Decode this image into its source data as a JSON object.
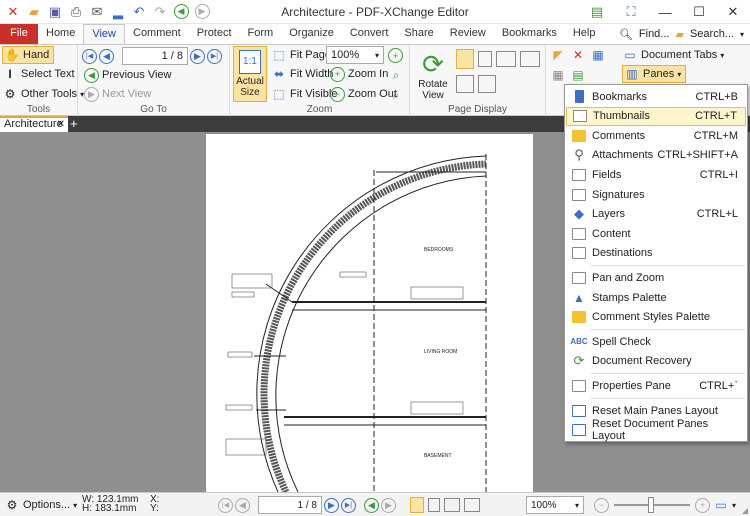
{
  "window": {
    "title": "Architecture - PDF-XChange Editor"
  },
  "quick_access": [
    "app-icon",
    "open-icon",
    "save-icon",
    "print-icon",
    "email-icon",
    "scan-icon",
    "undo-icon",
    "redo-icon",
    "back-icon",
    "forward-icon"
  ],
  "tabs": [
    {
      "label": "File",
      "name": "tab-file"
    },
    {
      "label": "Home",
      "name": "tab-home"
    },
    {
      "label": "View",
      "name": "tab-view",
      "active": true
    },
    {
      "label": "Comment",
      "name": "tab-comment"
    },
    {
      "label": "Protect",
      "name": "tab-protect"
    },
    {
      "label": "Form",
      "name": "tab-form"
    },
    {
      "label": "Organize",
      "name": "tab-organize"
    },
    {
      "label": "Convert",
      "name": "tab-convert"
    },
    {
      "label": "Share",
      "name": "tab-share"
    },
    {
      "label": "Review",
      "name": "tab-review"
    },
    {
      "label": "Bookmarks",
      "name": "tab-bookmarks"
    },
    {
      "label": "Help",
      "name": "tab-help"
    }
  ],
  "tabs_right": {
    "find": "Find...",
    "search": "Search..."
  },
  "ribbon": {
    "tools": {
      "hand": "Hand",
      "select_text": "Select Text",
      "other_tools": "Other Tools",
      "label": "Tools"
    },
    "goto": {
      "page_value": "1",
      "page_total": "/ 8",
      "previous_view": "Previous View",
      "next_view": "Next View",
      "label": "Go To"
    },
    "zoom": {
      "actual_size": "Actual Size",
      "fit_page": "Fit Page",
      "fit_width": "Fit Width",
      "fit_visible": "Fit Visible",
      "zoom_value": "100%",
      "zoom_in": "Zoom In",
      "zoom_out": "Zoom Out",
      "label": "Zoom"
    },
    "page_display": {
      "rotate_view": "Rotate View",
      "label": "Page Display"
    },
    "window": {
      "document_tabs": "Document Tabs",
      "panes": "Panes"
    }
  },
  "document_tab": {
    "label": "Architecture"
  },
  "drawing": {
    "bedrooms": "BEDROOMS",
    "living_room": "LIVING ROOM",
    "basement": "BASEMENT"
  },
  "status": {
    "options": "Options...",
    "width": "W: 123.1mm",
    "height": "H: 183.1mm",
    "x": "X:",
    "y": "Y:",
    "page_value": "1",
    "page_total": "/ 8",
    "zoom": "100%"
  },
  "panes_menu": {
    "items": [
      {
        "label": "Bookmarks",
        "shortcut": "CTRL+B",
        "icon": "bookmark-icon"
      },
      {
        "label": "Thumbnails",
        "shortcut": "CTRL+T",
        "icon": "thumbnails-icon",
        "highlighted": true
      },
      {
        "label": "Comments",
        "shortcut": "CTRL+M",
        "icon": "comments-icon"
      },
      {
        "label": "Attachments",
        "shortcut": "CTRL+SHIFT+A",
        "icon": "paperclip-icon"
      },
      {
        "label": "Fields",
        "shortcut": "CTRL+I",
        "icon": "fields-icon"
      },
      {
        "label": "Signatures",
        "shortcut": "",
        "icon": "signature-icon"
      },
      {
        "label": "Layers",
        "shortcut": "CTRL+L",
        "icon": "layers-icon"
      },
      {
        "label": "Content",
        "shortcut": "",
        "icon": "content-icon"
      },
      {
        "label": "Destinations",
        "shortcut": "",
        "icon": "destinations-icon"
      },
      {
        "label": "Pan and Zoom",
        "shortcut": "",
        "icon": "pan-zoom-icon"
      },
      {
        "label": "Stamps Palette",
        "shortcut": "",
        "icon": "stamp-icon"
      },
      {
        "label": "Comment Styles Palette",
        "shortcut": "",
        "icon": "comment-styles-icon"
      },
      {
        "label": "Spell Check",
        "shortcut": "",
        "icon": "spell-check-icon"
      },
      {
        "label": "Document Recovery",
        "shortcut": "",
        "icon": "recovery-icon"
      },
      {
        "label": "Properties Pane",
        "shortcut": "CTRL+`",
        "icon": "properties-icon"
      },
      {
        "label": "Reset Main Panes Layout",
        "shortcut": "",
        "icon": "reset-layout-icon"
      },
      {
        "label": "Reset Document Panes Layout",
        "shortcut": "",
        "icon": "reset-doc-layout-icon"
      }
    ]
  },
  "colors": {
    "file_tab": "#c8302b",
    "active_tab_text": "#1a4f9c",
    "highlight": "#fff6cc",
    "workspace": "#8f8f8f",
    "doc_tab_accent": "#e8a33c"
  }
}
